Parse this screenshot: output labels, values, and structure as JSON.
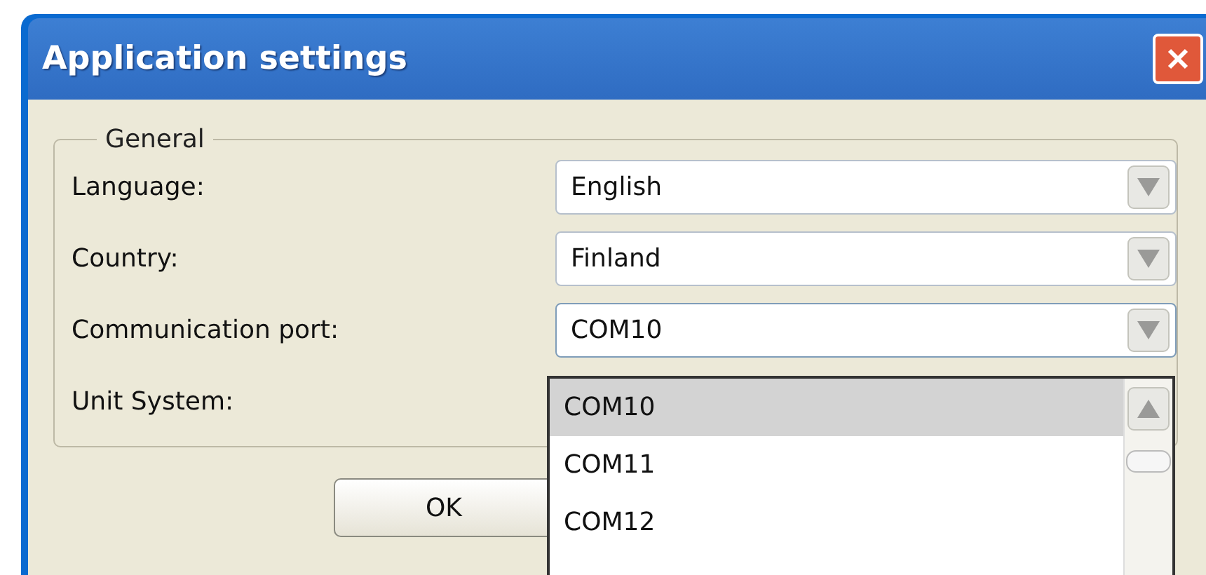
{
  "window": {
    "title": "Application settings"
  },
  "group": {
    "title": "General",
    "rows": [
      {
        "label": "Language:",
        "kind": "combo",
        "value": "English"
      },
      {
        "label": "Country:",
        "kind": "combo",
        "value": "Finland"
      },
      {
        "label": "Communication port:",
        "kind": "combo",
        "value": "COM10",
        "open": true
      },
      {
        "label": "Unit System:",
        "kind": "label"
      }
    ]
  },
  "dropdown": {
    "items": [
      {
        "label": "COM10",
        "selected": true
      },
      {
        "label": "COM11",
        "selected": false
      },
      {
        "label": "COM12",
        "selected": false
      }
    ]
  },
  "buttons": [
    {
      "label": "OK"
    }
  ]
}
